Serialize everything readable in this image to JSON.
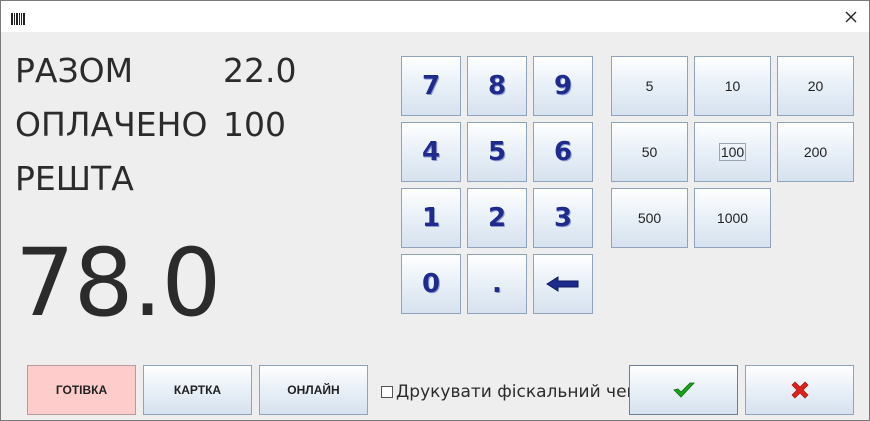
{
  "window": {
    "close_glyph": "✕"
  },
  "summary": {
    "total_label": "РАЗОМ",
    "total_value": "22.0",
    "paid_label": "ОПЛАЧЕНО",
    "paid_value": "100",
    "change_label": "РЕШТА",
    "change_value": "78.0"
  },
  "keypad": {
    "keys": [
      "7",
      "8",
      "9",
      "4",
      "5",
      "6",
      "1",
      "2",
      "3",
      "0",
      "."
    ],
    "backspace_glyph": "🡐"
  },
  "amounts": {
    "values": [
      "5",
      "10",
      "20",
      "50",
      "100",
      "200",
      "500",
      "1000"
    ],
    "selected": "100"
  },
  "payment_methods": {
    "cash": "ГОТІВКА",
    "card": "КАРТКА",
    "online": "ОНЛАЙН",
    "active": "cash"
  },
  "fiscal_check": {
    "label": "Друкувати фіскальний чек",
    "checked": false
  },
  "actions": {
    "ok_icon": "check-icon",
    "cancel_icon": "cross-icon"
  },
  "colors": {
    "accent_text": "#1e2a8c",
    "active_payment": "#ffcccc",
    "ok_green": "#1aa31a",
    "cancel_red": "#e0201a"
  }
}
